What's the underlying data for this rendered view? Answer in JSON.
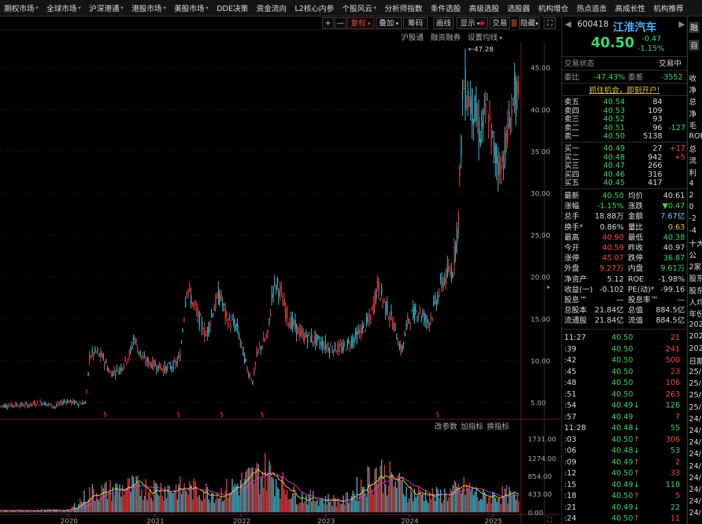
{
  "menu": [
    "期权市场",
    "全球市场",
    "沪深港通",
    "港股市场",
    "美股市场",
    "DDE决策",
    "资金流向",
    "L2核心内参",
    "个股风云",
    "分析师指数",
    "条件选股",
    "高级选股",
    "选股器",
    "机构增仓",
    "热点追击",
    "高成长性",
    "机构推荐"
  ],
  "menu_arrows": [
    true,
    true,
    true,
    true,
    true,
    false,
    false,
    false,
    true,
    false,
    false,
    false,
    false,
    false,
    false,
    false,
    false
  ],
  "toolbar": {
    "plus": "+",
    "minus": "—",
    "fuquan": "复权",
    "overlay": "叠加",
    "chips": "筹码",
    "draw": "画线",
    "show": "显示",
    "trade": "交易",
    "about": "简约",
    "hide": "隐藏",
    "expand": "⛶"
  },
  "subbar": [
    "沪股通",
    "融资融券",
    "设置均线"
  ],
  "chart": {
    "price_ticks": [
      "45.00",
      "40.00",
      "35.00",
      "30.00",
      "25.00",
      "20.00",
      "15.00",
      "10.00",
      "5.00"
    ],
    "vol_ticks": [
      "1731.00",
      "1274.00",
      "854.00",
      "433.00",
      "0.00"
    ],
    "years": [
      "2020",
      "2021",
      "2022",
      "2023",
      "2024",
      "2025"
    ],
    "max_label": "47.28",
    "vol_menu": [
      "改参数",
      "加指标",
      "换指标"
    ],
    "markers": [
      "§",
      "§",
      "§",
      "§",
      "§"
    ]
  },
  "chart_data": {
    "type": "candlestick",
    "ylim": [
      3,
      48
    ],
    "max_price": 47.28,
    "year_labels": [
      "2020",
      "2021",
      "2022",
      "2023",
      "2024",
      "2025"
    ],
    "trend": [
      [
        0,
        4.6
      ],
      [
        20,
        4.7
      ],
      [
        40,
        4.7
      ],
      [
        60,
        5.0
      ],
      [
        80,
        4.5
      ],
      [
        95,
        5.2
      ],
      [
        115,
        4.9
      ],
      [
        125,
        5.0
      ],
      [
        130,
        10.5
      ],
      [
        140,
        11.0
      ],
      [
        150,
        10.3
      ],
      [
        160,
        8.5
      ],
      [
        175,
        9.0
      ],
      [
        190,
        11.0
      ],
      [
        195,
        13.0
      ],
      [
        200,
        11.5
      ],
      [
        210,
        10.0
      ],
      [
        225,
        9.5
      ],
      [
        240,
        9.0
      ],
      [
        255,
        9.5
      ],
      [
        262,
        10.5
      ],
      [
        272,
        19.0
      ],
      [
        280,
        17.0
      ],
      [
        290,
        15.0
      ],
      [
        300,
        13.0
      ],
      [
        310,
        16.0
      ],
      [
        320,
        18.0
      ],
      [
        330,
        15.0
      ],
      [
        345,
        14.0
      ],
      [
        360,
        9.0
      ],
      [
        368,
        7.5
      ],
      [
        375,
        11.0
      ],
      [
        390,
        13.0
      ],
      [
        398,
        19.0
      ],
      [
        405,
        19.0
      ],
      [
        420,
        15.0
      ],
      [
        440,
        13.0
      ],
      [
        460,
        12.5
      ],
      [
        480,
        11.5
      ],
      [
        500,
        11.5
      ],
      [
        520,
        13.0
      ],
      [
        540,
        15.0
      ],
      [
        550,
        19.0
      ],
      [
        560,
        17.0
      ],
      [
        575,
        14.0
      ],
      [
        585,
        11.0
      ],
      [
        595,
        15.0
      ],
      [
        610,
        16.0
      ],
      [
        625,
        14.5
      ],
      [
        635,
        17.0
      ],
      [
        645,
        19.5
      ],
      [
        660,
        21.0
      ],
      [
        668,
        27.0
      ],
      [
        675,
        43.0
      ],
      [
        680,
        42.0
      ],
      [
        690,
        40.0
      ],
      [
        700,
        37.0
      ],
      [
        710,
        40.0
      ],
      [
        720,
        35.0
      ],
      [
        730,
        33.0
      ],
      [
        740,
        37.0
      ],
      [
        750,
        42.0
      ],
      [
        756,
        40.5
      ]
    ],
    "volume_peaks": [
      [
        0,
        60
      ],
      [
        100,
        80
      ],
      [
        130,
        700
      ],
      [
        190,
        900
      ],
      [
        270,
        850
      ],
      [
        320,
        700
      ],
      [
        388,
        1500
      ],
      [
        430,
        600
      ],
      [
        500,
        400
      ],
      [
        550,
        1500
      ],
      [
        600,
        700
      ],
      [
        640,
        600
      ],
      [
        680,
        900
      ],
      [
        700,
        550
      ],
      [
        740,
        650
      ],
      [
        756,
        400
      ]
    ],
    "indicator_lines": [
      "MA5",
      "MA10"
    ]
  },
  "right": {
    "code": "600418",
    "name": "江淮汽车",
    "price": "40.50",
    "change": "-0.47",
    "pct": "-1.15%",
    "trade_state_label": "交易状态",
    "trade_state": "交易中",
    "wb_label": "委比",
    "wb": "-47.43%",
    "wc_label": "委差",
    "wc": "-3552",
    "promo": "抓住机会，即刻开户!",
    "asks": [
      {
        "l": "卖五",
        "p": "40.54",
        "v": "84",
        "d": ""
      },
      {
        "l": "卖四",
        "p": "40.53",
        "v": "109",
        "d": ""
      },
      {
        "l": "卖三",
        "p": "40.52",
        "v": "93",
        "d": ""
      },
      {
        "l": "卖二",
        "p": "40.51",
        "v": "96",
        "d": "-127"
      },
      {
        "l": "卖一",
        "p": "40.50",
        "v": "5138",
        "d": ""
      }
    ],
    "bids": [
      {
        "l": "买一",
        "p": "40.49",
        "v": "27",
        "d": "+17"
      },
      {
        "l": "买二",
        "p": "40.48",
        "v": "942",
        "d": "+5"
      },
      {
        "l": "买三",
        "p": "40.47",
        "v": "266",
        "d": ""
      },
      {
        "l": "买四",
        "p": "40.46",
        "v": "316",
        "d": ""
      },
      {
        "l": "买五",
        "p": "40.45",
        "v": "417",
        "d": ""
      }
    ],
    "stats": [
      [
        "最新",
        "40.50",
        "均价",
        "40.61"
      ],
      [
        "涨幅",
        "-1.15%",
        "涨跌",
        "▼0.47"
      ],
      [
        "总手",
        "18.88万",
        "金额",
        "7.67亿"
      ],
      [
        "换手*",
        "0.86%",
        "量比",
        "0.63"
      ],
      [
        "最高",
        "40.90",
        "最低",
        "40.38"
      ],
      [
        "今开",
        "40.59",
        "昨收",
        "40.97"
      ],
      [
        "涨停",
        "45.07",
        "跌停",
        "36.87"
      ],
      [
        "外盘",
        "9.27万",
        "内盘",
        "9.61万"
      ],
      [
        "净资产",
        "5.12",
        "ROE",
        "-1.98%"
      ],
      [
        "收益(一)",
        "-0.102",
        "PE(动)*",
        "-99.16"
      ],
      [
        "股息™",
        "—",
        "股息率™",
        "—"
      ],
      [
        "总股本",
        "21.84亿",
        "总值",
        "884.5亿"
      ],
      [
        "流通股",
        "21.84亿",
        "流值",
        "884.5亿"
      ]
    ],
    "ticks": [
      {
        "t": "11:27",
        "p": "40.50",
        "a": "",
        "v": "21"
      },
      {
        "t": ":39",
        "p": "40.50",
        "a": "",
        "v": "241"
      },
      {
        "t": ":42",
        "p": "40.50",
        "a": "",
        "v": "500"
      },
      {
        "t": ":45",
        "p": "40.50",
        "a": "",
        "v": "23"
      },
      {
        "t": ":48",
        "p": "40.50",
        "a": "",
        "v": "106"
      },
      {
        "t": ":51",
        "p": "40.50",
        "a": "",
        "v": "263"
      },
      {
        "t": ":54",
        "p": "40.49",
        "a": "↓",
        "v": "126"
      },
      {
        "t": ":57",
        "p": "40.49",
        "a": "",
        "v": "7"
      },
      {
        "t": "11:28",
        "p": "40.48",
        "a": "↓",
        "v": "55"
      },
      {
        "t": ":03",
        "p": "40.50",
        "a": "↑",
        "v": "306"
      },
      {
        "t": ":06",
        "p": "40.48",
        "a": "↓",
        "v": "53"
      },
      {
        "t": ":09",
        "p": "40.49",
        "a": "↑",
        "v": "2"
      },
      {
        "t": ":12",
        "p": "40.50",
        "a": "↑",
        "v": "33"
      },
      {
        "t": ":15",
        "p": "40.49",
        "a": "↓",
        "v": "118"
      },
      {
        "t": ":18",
        "p": "40.50",
        "a": "↑",
        "v": "5"
      },
      {
        "t": ":21",
        "p": "40.49",
        "a": "↓",
        "v": "22"
      },
      {
        "t": ":24",
        "p": "40.50",
        "a": "↑",
        "v": "11"
      }
    ]
  },
  "far": {
    "top": [
      "融",
      "自"
    ],
    "list": [
      "收",
      "净",
      "总",
      "净",
      "毛",
      "ROE",
      "总",
      "流",
      "利",
      "4",
      "2",
      "0",
      "-2",
      "-4",
      "十大",
      "公",
      "2家",
      "股东",
      "股东",
      "人均",
      "年份",
      "202",
      "202",
      "202",
      "日期",
      "25/",
      "25/",
      "25/",
      "25/",
      "24/",
      "24/",
      "24/",
      "24/",
      "24/",
      "24/",
      "24/",
      "24/",
      "24/"
    ]
  }
}
